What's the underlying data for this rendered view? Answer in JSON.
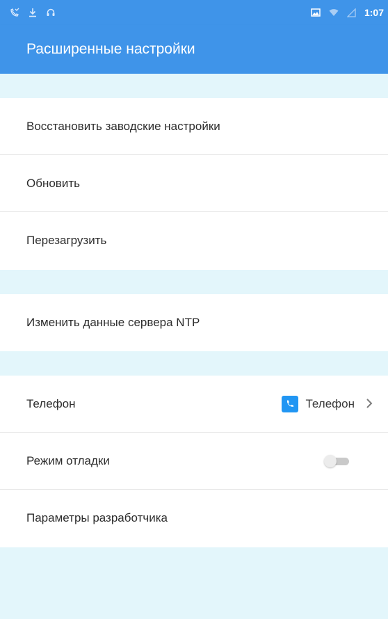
{
  "status_bar": {
    "time": "1:07",
    "left_icons": [
      "phone-missed-icon",
      "download-icon",
      "headset-icon"
    ],
    "right_icons": [
      "photo-icon",
      "wifi-icon",
      "signal-icon"
    ]
  },
  "app_bar": {
    "title": "Расширенные настройки"
  },
  "groups": [
    {
      "items": [
        {
          "label": "Восстановить заводские настройки"
        },
        {
          "label": "Обновить"
        },
        {
          "label": "Перезагрузить"
        }
      ]
    },
    {
      "items": [
        {
          "label": "Изменить данные сервера NTP"
        }
      ]
    },
    {
      "items": [
        {
          "label": "Телефон",
          "value": "Телефон",
          "value_icon": "phone-icon"
        },
        {
          "label": "Режим отладки",
          "toggle": false
        },
        {
          "label": "Параметры разработчика"
        }
      ]
    }
  ],
  "colors": {
    "primary": "#3f94e9",
    "section_bg": "#e3f6fb",
    "accent": "#2196f3"
  }
}
